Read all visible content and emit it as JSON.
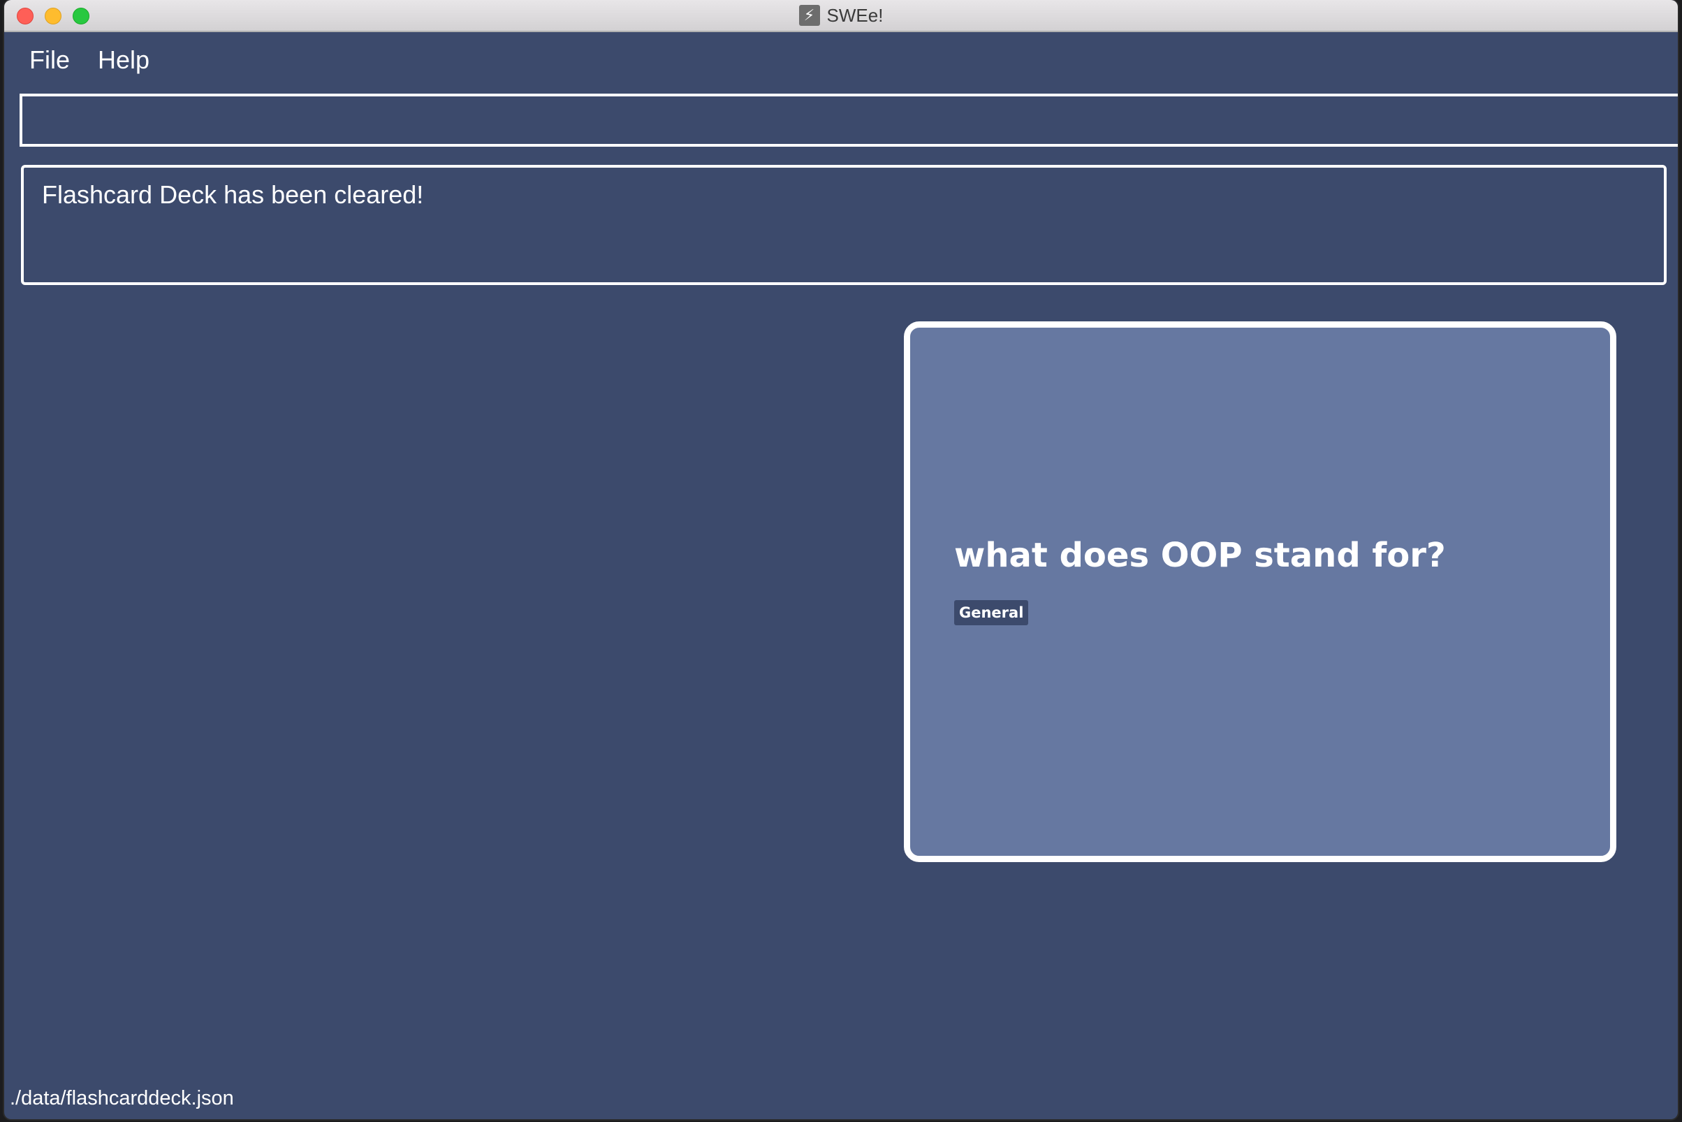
{
  "window": {
    "title": "SWEe!",
    "icon": "lightning-icon",
    "background_color": "#3c4a6c"
  },
  "menu": {
    "items": [
      {
        "label": "File"
      },
      {
        "label": "Help"
      }
    ]
  },
  "command_box": {
    "value": "",
    "placeholder": ""
  },
  "result_display": {
    "message": "Flashcard Deck has been cleared!"
  },
  "flashcard": {
    "question": "what does OOP stand for?",
    "tag": "General",
    "card_color": "#6678a1",
    "tag_color": "#3c4a6c"
  },
  "status_bar": {
    "file_path": "./data/flashcarddeck.json"
  }
}
